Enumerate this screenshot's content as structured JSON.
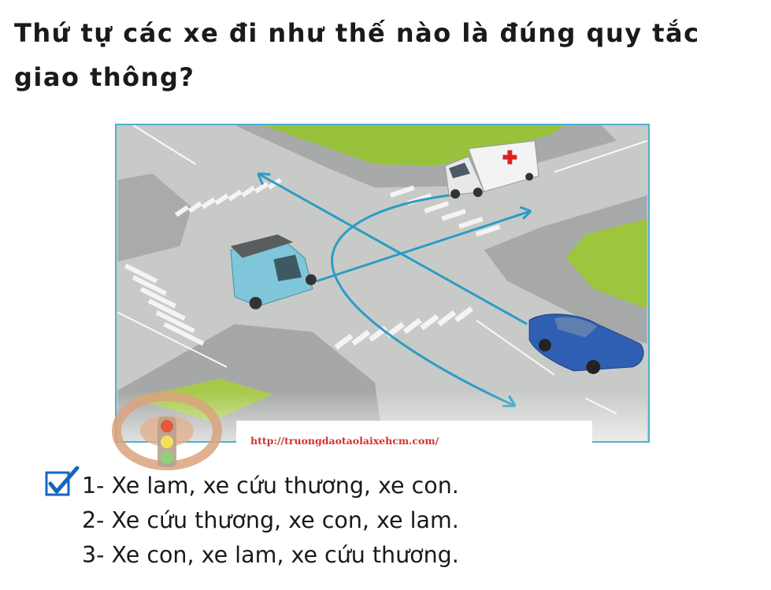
{
  "question": "Thứ tự các xe đi như thế nào là đúng quy tắc giao thông?",
  "watermark_url": "http://truongdaotaolaixehcm.com/",
  "answers": [
    {
      "text": "1- Xe lam, xe cứu thương, xe con.",
      "checked": true
    },
    {
      "text": "2- Xe cứu thương, xe con, xe lam.",
      "checked": false
    },
    {
      "text": "3- Xe con, xe lam, xe cứu thương.",
      "checked": false
    }
  ],
  "colors": {
    "frame": "#4fb0cf",
    "arrow": "#2c9bc7",
    "check": "#1565c0",
    "url": "#d2322d",
    "grass": "#98c23c"
  },
  "icons": {
    "checkbox": "checkbox-checked-icon",
    "ambulance": "ambulance-icon",
    "auto_rickshaw": "auto-rickshaw-icon",
    "car": "sedan-car-icon",
    "traffic_light": "traffic-light-icon",
    "steering_wheel": "steering-wheel-icon"
  }
}
